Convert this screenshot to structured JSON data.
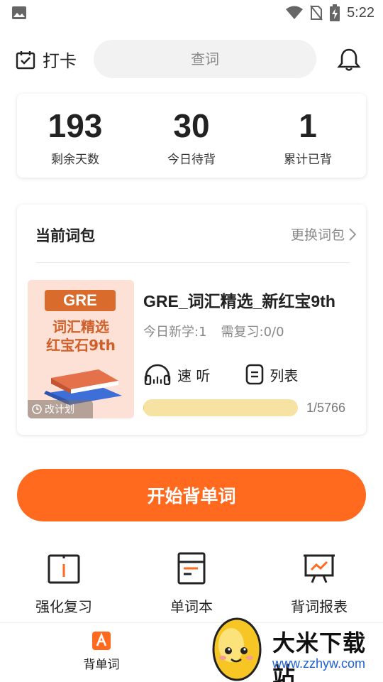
{
  "status_bar": {
    "time": "5:22",
    "icons": [
      "image-icon",
      "wifi-icon",
      "no-sim-icon",
      "battery-charging-icon"
    ]
  },
  "topbar": {
    "checkin_label": "打卡",
    "search_placeholder": "查词",
    "icons": [
      "calendar-check-icon",
      "bell-icon"
    ]
  },
  "stats": [
    {
      "value": "193",
      "label": "剩余天数"
    },
    {
      "value": "30",
      "label": "今日待背"
    },
    {
      "value": "1",
      "label": "累计已背"
    }
  ],
  "current_pack": {
    "header": "当前词包",
    "change_label": "更换词包",
    "cover": {
      "badge": "GRE",
      "line1": "词汇精选",
      "line2": "红宝石9th",
      "plan_label": "改计划"
    },
    "name": "GRE_词汇精选_新红宝9th",
    "new_today": "今日新学:1",
    "review": "需复习:0/0",
    "listen_label": "速 听",
    "list_label": "列表",
    "progress": {
      "current": 1,
      "total": 5766,
      "text": "1/5766"
    }
  },
  "start_button": "开始背单词",
  "tools": [
    {
      "label": "强化复习",
      "icon": "review-book-icon"
    },
    {
      "label": "单词本",
      "icon": "notebook-icon"
    },
    {
      "label": "背词报表",
      "icon": "chart-board-icon"
    }
  ],
  "bottom_nav": {
    "items": [
      {
        "label": "背单词",
        "icon": "a-letter-icon",
        "active": true
      }
    ]
  },
  "watermark": {
    "brand": "大米下载站",
    "site": "www.zzhyw.com"
  },
  "colors": {
    "accent": "#ff6a1f",
    "progress_track": "#f6e3a3",
    "progress_fill": "#f0c64a"
  }
}
